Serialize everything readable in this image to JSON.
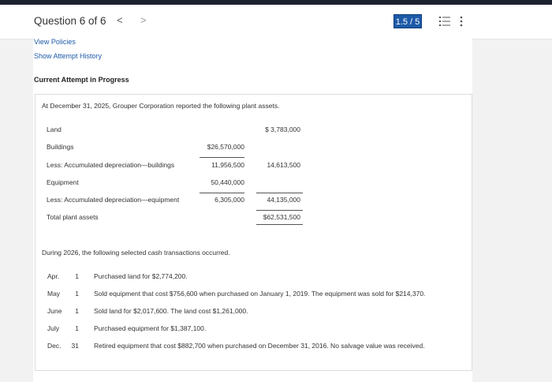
{
  "header": {
    "question": "Question 6 of 6",
    "prev": "<",
    "next": ">",
    "score": "1.5 / 5"
  },
  "links": {
    "policies": "View Policies",
    "history": "Show Attempt History"
  },
  "section_caption": "Current Attempt in Progress",
  "problem": {
    "intro": "At December 31, 2025, Grouper Corporation reported the following plant assets.",
    "assets": [
      {
        "label": "Land",
        "col1": "",
        "col2": "$ 3,783,000"
      },
      {
        "label": "Buildings",
        "col1": "$26,570,000",
        "col2": ""
      },
      {
        "label": "Less: Accumulated depreciation—buildings",
        "col1": "11,956,500",
        "col2": "14,613,500"
      },
      {
        "label": "Equipment",
        "col1": "50,440,000",
        "col2": ""
      },
      {
        "label": "Less: Accumulated depreciation—equipment",
        "col1": "6,305,000",
        "col2": "44,135,000"
      },
      {
        "label": "Total plant assets",
        "col1": "",
        "col2": "$62,531,500"
      }
    ],
    "transactions_intro": "During 2026, the following selected cash transactions occurred.",
    "transactions": [
      {
        "month": "Apr.",
        "day": "1",
        "text": "Purchased land for $2,774,200."
      },
      {
        "month": "May",
        "day": "1",
        "text": "Sold equipment that cost $756,600 when purchased on January 1, 2019. The equipment was sold for $214,370."
      },
      {
        "month": "June",
        "day": "1",
        "text": "Sold land for $2,017,600. The land cost $1,261,000."
      },
      {
        "month": "July",
        "day": "1",
        "text": "Purchased equipment for $1,387,100."
      },
      {
        "month": "Dec.",
        "day": "31",
        "text": "Retired equipment that cost $882,700 when purchased on December 31, 2016. No salvage value was received."
      }
    ]
  },
  "colors": {
    "accent": "#1d5aa8",
    "topbar": "#1c2230"
  },
  "icons": {
    "list": "list-icon",
    "more": "more-vertical-icon"
  }
}
